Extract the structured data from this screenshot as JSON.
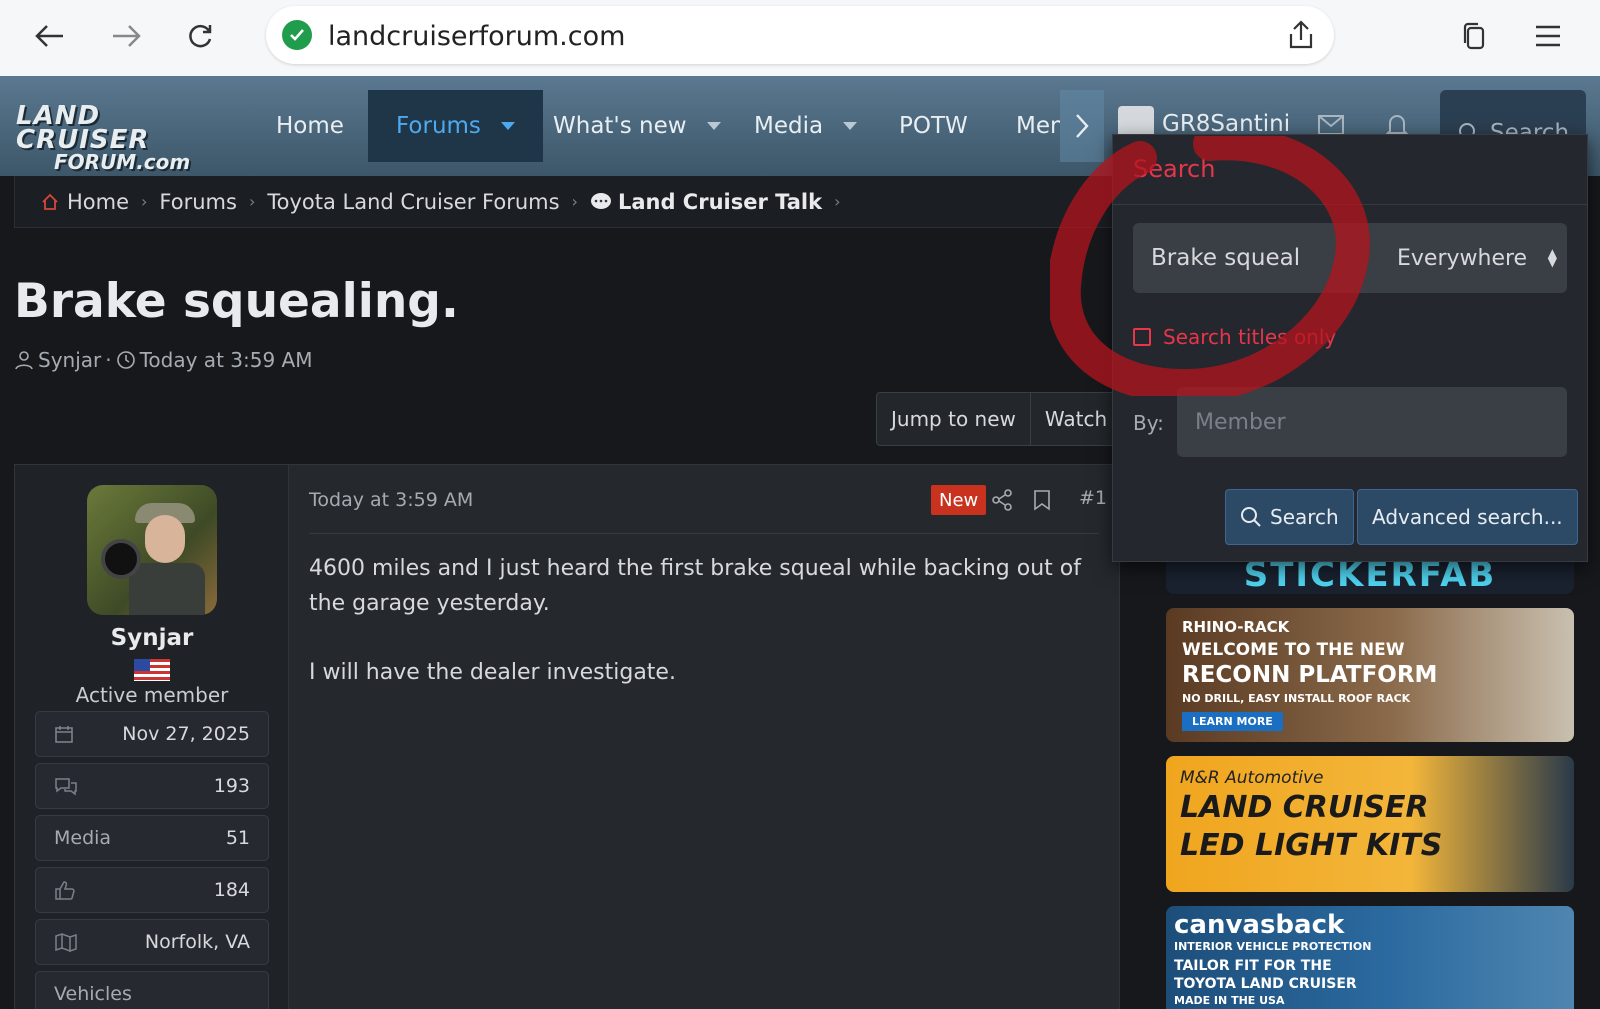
{
  "browser": {
    "url": "landcruiserforum.com",
    "icons": [
      "back-arrow-icon",
      "forward-arrow-icon",
      "reload-icon",
      "share-icon",
      "tabs-icon",
      "menu-icon"
    ]
  },
  "header": {
    "logo_line1": "LAND CRUISER",
    "logo_line2": "FORUM.com",
    "nav": {
      "home": "Home",
      "forums": "Forums",
      "whats_new": "What's new",
      "media": "Media",
      "potw": "POTW",
      "members": "Men"
    },
    "username": "GR8Santini",
    "search_label": "Search"
  },
  "breadcrumb": {
    "home": "Home",
    "forums": "Forums",
    "toyota": "Toyota Land Cruiser Forums",
    "talk": "Land Cruiser Talk"
  },
  "thread": {
    "title": "Brake squealing.",
    "author": "Synjar",
    "date": "Today at 3:59 AM",
    "jump_label": "Jump to new",
    "watch_label": "Watch"
  },
  "post": {
    "date": "Today at 3:59 AM",
    "badge": "New",
    "number": "#1",
    "paragraphs": [
      "4600 miles and I just heard the first brake squeal while backing out of the garage yesterday.",
      "I will have the dealer investigate."
    ]
  },
  "user": {
    "name": "Synjar",
    "title": "Active member",
    "joined": "Nov 27, 2025",
    "messages": "193",
    "media_label": "Media",
    "media": "51",
    "reactions": "184",
    "location": "Norfolk, VA",
    "vehicles_label": "Vehicles"
  },
  "search": {
    "header": "Search",
    "query": "Brake squeal",
    "scope": "Everywhere",
    "titles_only": "Search titles only",
    "by_label": "By:",
    "member_placeholder": "Member",
    "search_button": "Search",
    "advanced_button": "Advanced search..."
  },
  "ads": {
    "stickerfab": "STICKERFAB",
    "rhino_brand": "RHINO-RACK",
    "rhino_line1": "WELCOME TO THE NEW",
    "rhino_line2": "RECONN PLATFORM",
    "rhino_line3": "NO DRILL, EASY INSTALL ROOF RACK",
    "rhino_cta": "LEARN MORE",
    "mr_brand": "M&R Automotive",
    "mr_line1": "LAND CRUISER",
    "mr_line2": "LED LIGHT KITS",
    "canvas_brand": "canvasback",
    "canvas_line1": "INTERIOR VEHICLE PROTECTION",
    "canvas_line2": "TAILOR FIT FOR THE",
    "canvas_line3": "TOYOTA LAND CRUISER",
    "canvas_line4": "MADE IN THE USA"
  },
  "colors": {
    "accent_blue": "#4fa9ee",
    "search_red": "#e8354a",
    "new_badge": "#c8321e",
    "annotation_red": "#b4141e"
  }
}
